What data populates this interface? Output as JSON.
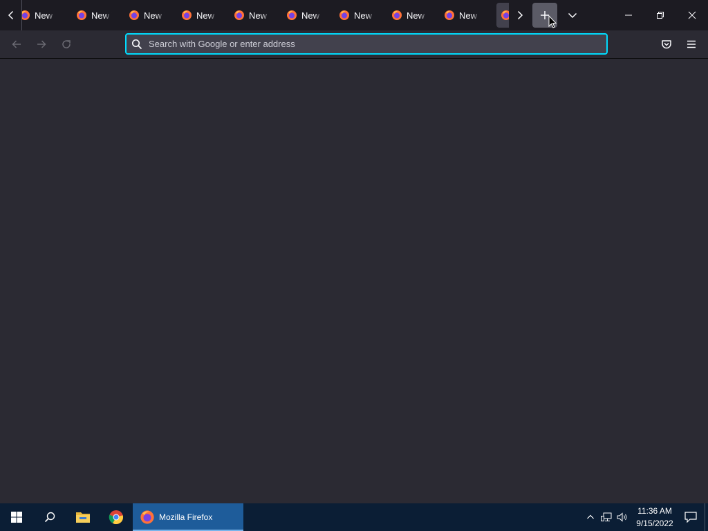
{
  "browser": {
    "tabs": [
      {
        "label": "New Tab"
      },
      {
        "label": "New Tab"
      },
      {
        "label": "New Tab"
      },
      {
        "label": "New Tab"
      },
      {
        "label": "New Tab"
      },
      {
        "label": "New Tab"
      },
      {
        "label": "New Tab"
      },
      {
        "label": "New Tab"
      },
      {
        "label": "New Tab"
      }
    ],
    "active_tab_icon": "firefox-icon",
    "urlbar": {
      "placeholder": "Search with Google or enter address",
      "value": ""
    },
    "colors": {
      "accent_focus": "#00ddff",
      "toolbar": "#2b2a33",
      "tabstrip": "#1c1b22"
    }
  },
  "taskbar": {
    "firefox_label": "Mozilla Firefox",
    "time": "11:36 AM",
    "date": "9/15/2022",
    "pinned": [
      "windows-start-icon",
      "search-icon",
      "file-explorer-icon",
      "chrome-icon",
      "firefox-icon"
    ]
  }
}
